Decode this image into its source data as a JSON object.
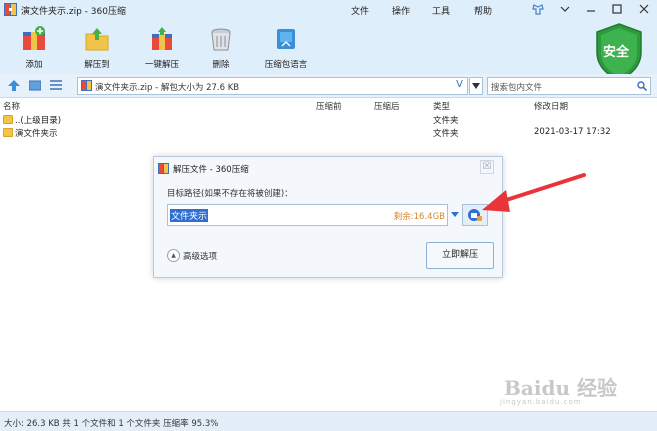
{
  "window": {
    "title": "演文件夹示.zip - 360压缩",
    "menu": [
      "文件",
      "操作",
      "工具",
      "帮助"
    ]
  },
  "toolbar": {
    "tools": [
      {
        "label": "添加",
        "icon": "add-archive-icon"
      },
      {
        "label": "解压到",
        "icon": "extract-to-icon"
      },
      {
        "label": "一键解压",
        "icon": "one-click-extract-icon"
      },
      {
        "label": "删除",
        "icon": "trash-icon"
      },
      {
        "label": "压缩包语言",
        "icon": "archive-language-icon"
      }
    ],
    "security_badge": "安全"
  },
  "addressbar": {
    "path": "演文件夹示.zip - 解包大小为 27.6 KB",
    "path_v": "V",
    "search_placeholder": "搜索包内文件"
  },
  "filelist": {
    "columns": [
      "名称",
      "压缩前",
      "压缩后",
      "类型",
      "修改日期"
    ],
    "rows": [
      {
        "name": "..(上级目录)",
        "type": "文件夹",
        "date": ""
      },
      {
        "name": "演文件夹示",
        "type": "文件夹",
        "date": "2021-03-17 17:32"
      }
    ]
  },
  "statusbar": {
    "text": "大小: 26.3 KB 共 1 个文件和 1 个文件夹 压缩率 95.3%"
  },
  "dialog": {
    "title": "解压文件 - 360压缩",
    "close": "☒",
    "target_label": "目标路径(如果不存在将被创建)：",
    "target_value": "文件夹示",
    "free_space": "剩余:16.4GB",
    "advanced_label": "高级选项",
    "extract_button": "立即解压"
  },
  "watermark": {
    "line1": "Baidu 经验",
    "line2": "jingyan.baidu.com"
  },
  "colors": {
    "chrome": "#dfeefb",
    "accent": "#2f6fd1",
    "arrow": "#e8343a",
    "shield": "#2e9a3e"
  }
}
